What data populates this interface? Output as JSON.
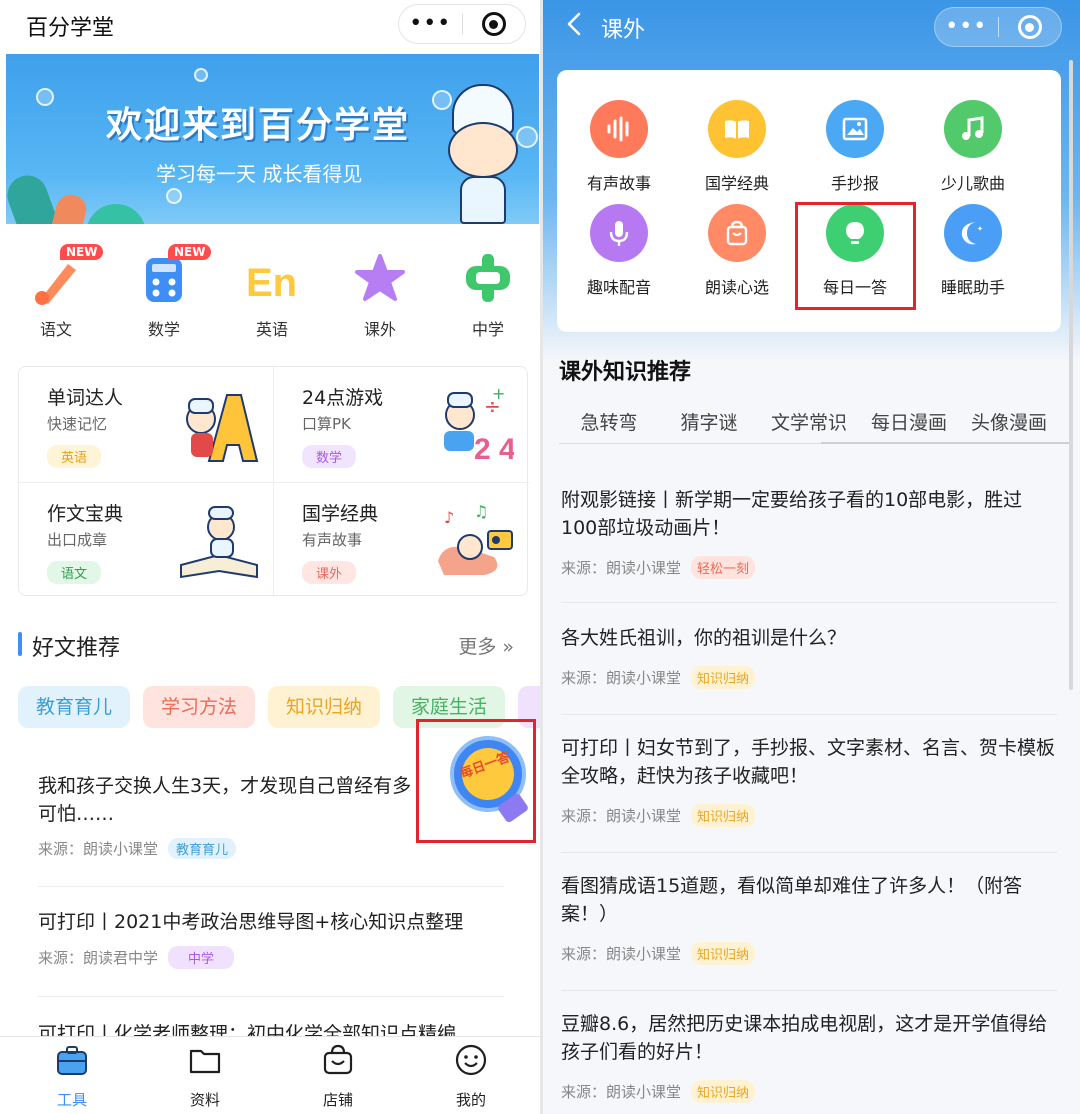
{
  "left": {
    "header": {
      "title": "百分学堂"
    },
    "banner": {
      "title": "欢迎来到百分学堂",
      "subtitle": "学习每一天 成长看得见"
    },
    "categories": [
      {
        "label": "语文",
        "badge": "NEW",
        "icon": "pen-icon"
      },
      {
        "label": "数学",
        "badge": "NEW",
        "icon": "calculator-icon"
      },
      {
        "label": "英语",
        "badge": "",
        "icon": "english-en-icon"
      },
      {
        "label": "课外",
        "badge": "",
        "icon": "star-icon"
      },
      {
        "label": "中学",
        "badge": "",
        "icon": "zhong-icon"
      }
    ],
    "tools": [
      {
        "title": "单词达人",
        "sub": "快速记忆",
        "tag": "英语"
      },
      {
        "title": "24点游戏",
        "sub": "口算PK",
        "tag": "数学"
      },
      {
        "title": "作文宝典",
        "sub": "出口成章",
        "tag": "语文"
      },
      {
        "title": "国学经典",
        "sub": "有声故事",
        "tag": "课外"
      }
    ],
    "section": {
      "title": "好文推荐",
      "more": "更多 »"
    },
    "chips": [
      "教育育儿",
      "学习方法",
      "知识归纳",
      "家庭生活"
    ],
    "articles": [
      {
        "title": "我和孩子交换人生3天，才发现自己曾经有多可怕……",
        "source": "来源：朗读小课堂",
        "tag": "教育育儿"
      },
      {
        "title": "可打印丨2021中考政治思维导图+核心知识点整理",
        "source": "来源：朗读君中学",
        "tag": "中学"
      },
      {
        "title": "可打印丨化学老师整理：初中化学全部知识点精编",
        "source": "",
        "tag": ""
      }
    ],
    "float_button": {
      "text": "每日一答"
    },
    "tabbar": [
      {
        "label": "工具",
        "icon": "toolbox-icon",
        "active": true
      },
      {
        "label": "资料",
        "icon": "folder-icon",
        "active": false
      },
      {
        "label": "店铺",
        "icon": "shop-bag-icon",
        "active": false
      },
      {
        "label": "我的",
        "icon": "smile-icon",
        "active": false
      }
    ]
  },
  "right": {
    "header": {
      "title": "课外"
    },
    "functions": [
      {
        "label": "有声故事",
        "icon": "sound-wave-icon",
        "color": "#ff7a5a"
      },
      {
        "label": "国学经典",
        "icon": "book-icon",
        "color": "#ffc233"
      },
      {
        "label": "手抄报",
        "icon": "picture-icon",
        "color": "#4aa8f5"
      },
      {
        "label": "少儿歌曲",
        "icon": "music-note-icon",
        "color": "#52c96a"
      },
      {
        "label": "趣味配音",
        "icon": "microphone-icon",
        "color": "#b679f2"
      },
      {
        "label": "朗读心选",
        "icon": "bag-icon",
        "color": "#ff8a65"
      },
      {
        "label": "每日一答",
        "icon": "lightbulb-icon",
        "color": "#3fcf73"
      },
      {
        "label": "睡眠助手",
        "icon": "moon-icon",
        "color": "#4a9ef5"
      }
    ],
    "knowledge": {
      "title": "课外知识推荐",
      "tabs": [
        "急转弯",
        "猜字谜",
        "文学常识",
        "每日漫画",
        "头像漫画"
      ]
    },
    "articles": [
      {
        "title": "附观影链接丨新学期一定要给孩子看的10部电影，胜过100部垃圾动画片！",
        "source": "来源：朗读小课堂",
        "tag": "轻松一刻"
      },
      {
        "title": "各大姓氏祖训，你的祖训是什么？",
        "source": "来源：朗读小课堂",
        "tag": "知识归纳"
      },
      {
        "title": "可打印丨妇女节到了，手抄报、文字素材、名言、贺卡模板全攻略，赶快为孩子收藏吧！",
        "source": "来源：朗读小课堂",
        "tag": "知识归纳"
      },
      {
        "title": "看图猜成语15道题，看似简单却难住了许多人！（附答案！）",
        "source": "来源：朗读小课堂",
        "tag": "知识归纳"
      },
      {
        "title": "豆瓣8.6，居然把历史课本拍成电视剧，这才是开学值得给孩子们看的好片！",
        "source": "来源：朗读小课堂",
        "tag": "知识归纳"
      }
    ]
  },
  "colors": {
    "accent": "#3b8ff5",
    "highlight_box": "#e0262b"
  }
}
